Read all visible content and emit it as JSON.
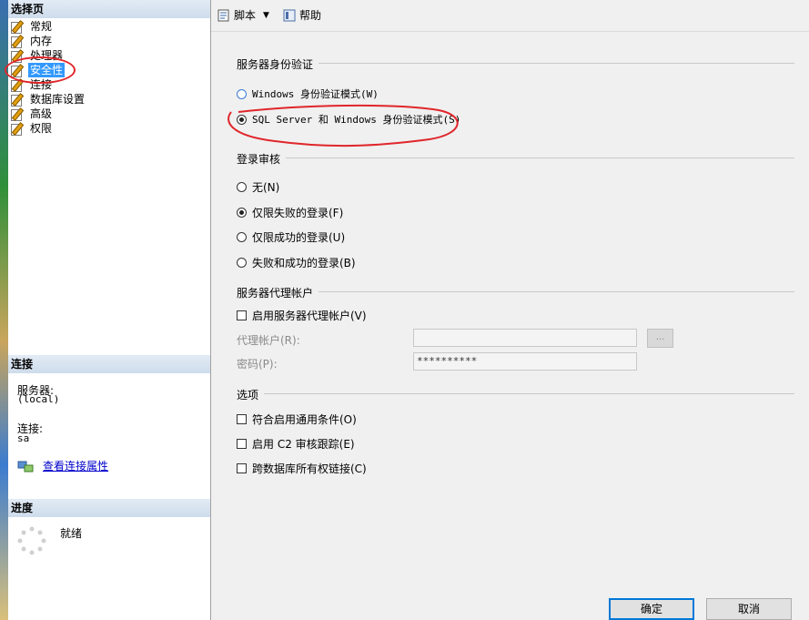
{
  "left_panel": {
    "select_page_header": "选择页",
    "pages": [
      "常规",
      "内存",
      "处理器",
      "安全性",
      "连接",
      "数据库设置",
      "高级",
      "权限"
    ],
    "selected_page": "安全性",
    "connection": {
      "header": "连接",
      "server_label": "服务器:",
      "server_value": "(local)",
      "connection_label": "连接:",
      "connection_value": "sa",
      "view_properties_link": "查看连接属性"
    },
    "progress": {
      "header": "进度",
      "status": "就绪"
    }
  },
  "toolbar": {
    "script_label": "脚本",
    "help_label": "帮助"
  },
  "server_auth": {
    "title": "服务器身份验证",
    "windows_mode": "Windows 身份验证模式(W)",
    "mixed_mode": "SQL Server 和 Windows 身份验证模式(S)",
    "selected": "mixed"
  },
  "login_audit": {
    "title": "登录审核",
    "none": "无(N)",
    "failed_only": "仅限失败的登录(F)",
    "successful_only": "仅限成功的登录(U)",
    "both": "失败和成功的登录(B)",
    "selected": "failed_only"
  },
  "proxy_account": {
    "title": "服务器代理帐户",
    "enable_label": "启用服务器代理帐户(V)",
    "proxy_account_label": "代理帐户(R):",
    "password_label": "密码(P):",
    "password_value": "**********",
    "browse_button": "..."
  },
  "options": {
    "title": "选项",
    "common_criteria": "符合启用通用条件(O)",
    "c2_audit": "启用 C2 审核跟踪(E)",
    "cross_db_chaining": "跨数据库所有权链接(C)"
  },
  "buttons": {
    "ok": "确定",
    "cancel": "取消"
  },
  "colors": {
    "selection": "#3399ff",
    "annotation_red": "#e0262b",
    "default_button_border": "#0078d7"
  }
}
